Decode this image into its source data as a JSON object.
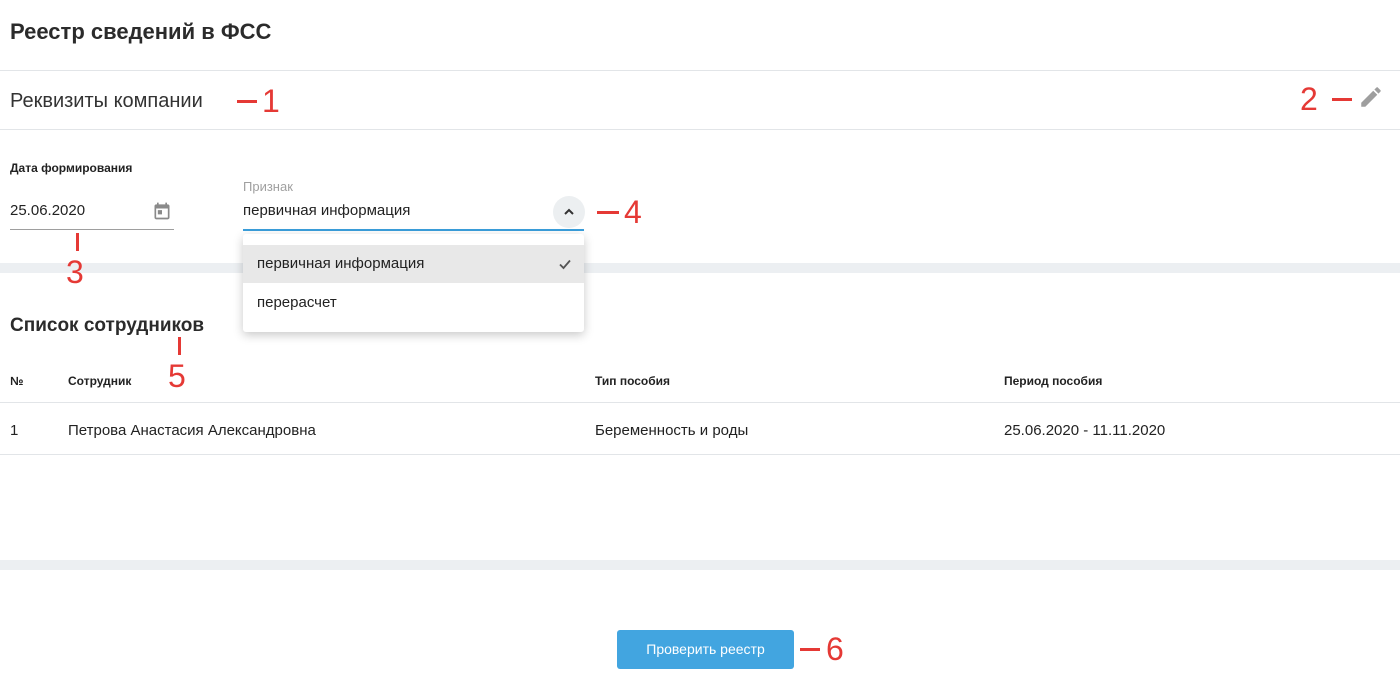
{
  "page": {
    "title": "Реестр сведений в ФСС"
  },
  "requisites": {
    "label": "Реквизиты компании",
    "edit_icon": "pencil-icon"
  },
  "form": {
    "date": {
      "label": "Дата формирования",
      "value": "25.06.2020",
      "icon": "calendar-icon"
    },
    "sign": {
      "label": "Признак",
      "value": "первичная информация",
      "icon": "chevron-up-icon",
      "options": [
        {
          "label": "первичная информация",
          "selected": true
        },
        {
          "label": "перерасчет",
          "selected": false
        }
      ]
    }
  },
  "employees": {
    "title": "Список сотрудников",
    "columns": [
      "№",
      "Сотрудник",
      "Тип пособия",
      "Период пособия"
    ],
    "rows": [
      [
        "1",
        "Петрова Анастасия Александровна",
        "Беременность и роды",
        "25.06.2020 - 11.11.2020"
      ]
    ]
  },
  "actions": {
    "check_label": "Проверить реестр"
  },
  "annotations": [
    "1",
    "2",
    "3",
    "4",
    "5",
    "6"
  ],
  "colors": {
    "accent": "#42a5e0",
    "annotation": "#e53935",
    "focus_underline": "#3a9edb"
  }
}
